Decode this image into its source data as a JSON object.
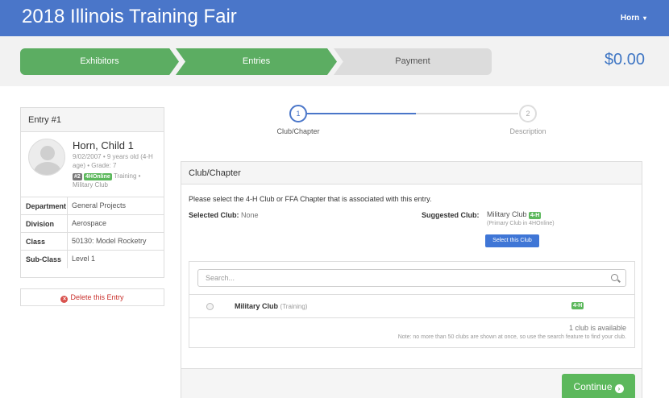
{
  "header": {
    "title": "2018 Illinois Training Fair",
    "user": "Horn",
    "user_caret": "▾"
  },
  "progress": {
    "steps": [
      "Exhibitors",
      "Entries",
      "Payment"
    ],
    "total": "$0.00"
  },
  "entry": {
    "title": "Entry #1",
    "name": "Horn, Child 1",
    "meta": "9/02/2007 • 9 years old (4-H age) • Grade: 7",
    "badge_num": "#2",
    "badge_online": "4HOnline",
    "tag_suffix": "Training • Military Club",
    "fields": [
      {
        "label": "Department",
        "value": "General Projects"
      },
      {
        "label": "Division",
        "value": "Aerospace"
      },
      {
        "label": "Class",
        "value": "50130: Model Rocketry"
      },
      {
        "label": "Sub-Class",
        "value": "Level 1"
      }
    ],
    "delete_label": "Delete this Entry",
    "delete_icon": "×"
  },
  "wizard": {
    "step1_num": "1",
    "step1_label": "Club/Chapter",
    "step2_num": "2",
    "step2_label": "Description"
  },
  "club": {
    "heading": "Club/Chapter",
    "prompt": "Please select the 4-H Club or FFA Chapter that is associated with this entry.",
    "selected_label": "Selected Club:",
    "selected_value": "None",
    "suggested_label": "Suggested Club:",
    "suggested_name": "Military Club",
    "suggested_tag": "4-H",
    "suggested_sub": "(Primary Club in 4HOnline)",
    "select_button": "Select this Club",
    "search_placeholder": "Search...",
    "result_name": "Military Club",
    "result_type": "(Training)",
    "result_tag": "4-H",
    "available": "1 club is available",
    "note": "Note: no more than 50 clubs are shown at once, so use the search feature to find your club."
  },
  "footer": {
    "continue_label": "Continue",
    "continue_icon": "›"
  },
  "colors": {
    "brand": "#4a76c9",
    "success": "#5cb85c",
    "danger": "#d9534f"
  }
}
